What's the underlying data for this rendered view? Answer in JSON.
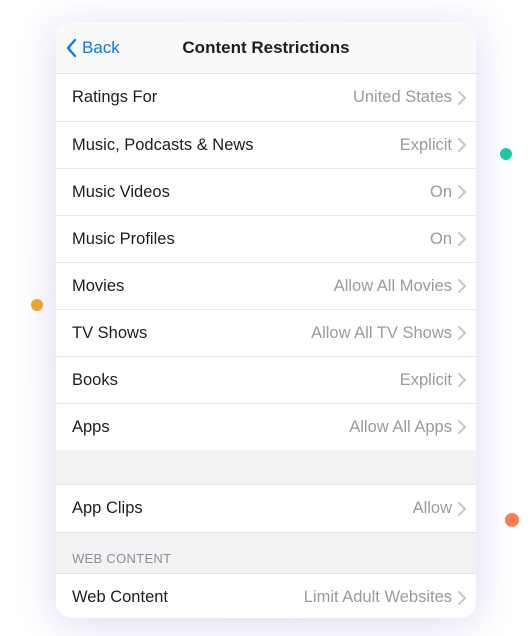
{
  "colors": {
    "accent": "#007aff"
  },
  "nav": {
    "back_label": "Back",
    "title": "Content Restrictions"
  },
  "section_main": {
    "rows": [
      {
        "label": "Ratings For",
        "value": "United States"
      },
      {
        "label": "Music, Podcasts & News",
        "value": "Explicit"
      },
      {
        "label": "Music Videos",
        "value": "On"
      },
      {
        "label": "Music Profiles",
        "value": "On"
      },
      {
        "label": "Movies",
        "value": "Allow All Movies"
      },
      {
        "label": "TV Shows",
        "value": "Allow All TV Shows"
      },
      {
        "label": "Books",
        "value": "Explicit"
      },
      {
        "label": "Apps",
        "value": "Allow All Apps"
      }
    ]
  },
  "section_appclips": {
    "rows": [
      {
        "label": "App Clips",
        "value": "Allow"
      }
    ]
  },
  "section_web": {
    "header": "WEB CONTENT",
    "rows": [
      {
        "label": "Web Content",
        "value": "Limit Adult Websites"
      }
    ]
  }
}
